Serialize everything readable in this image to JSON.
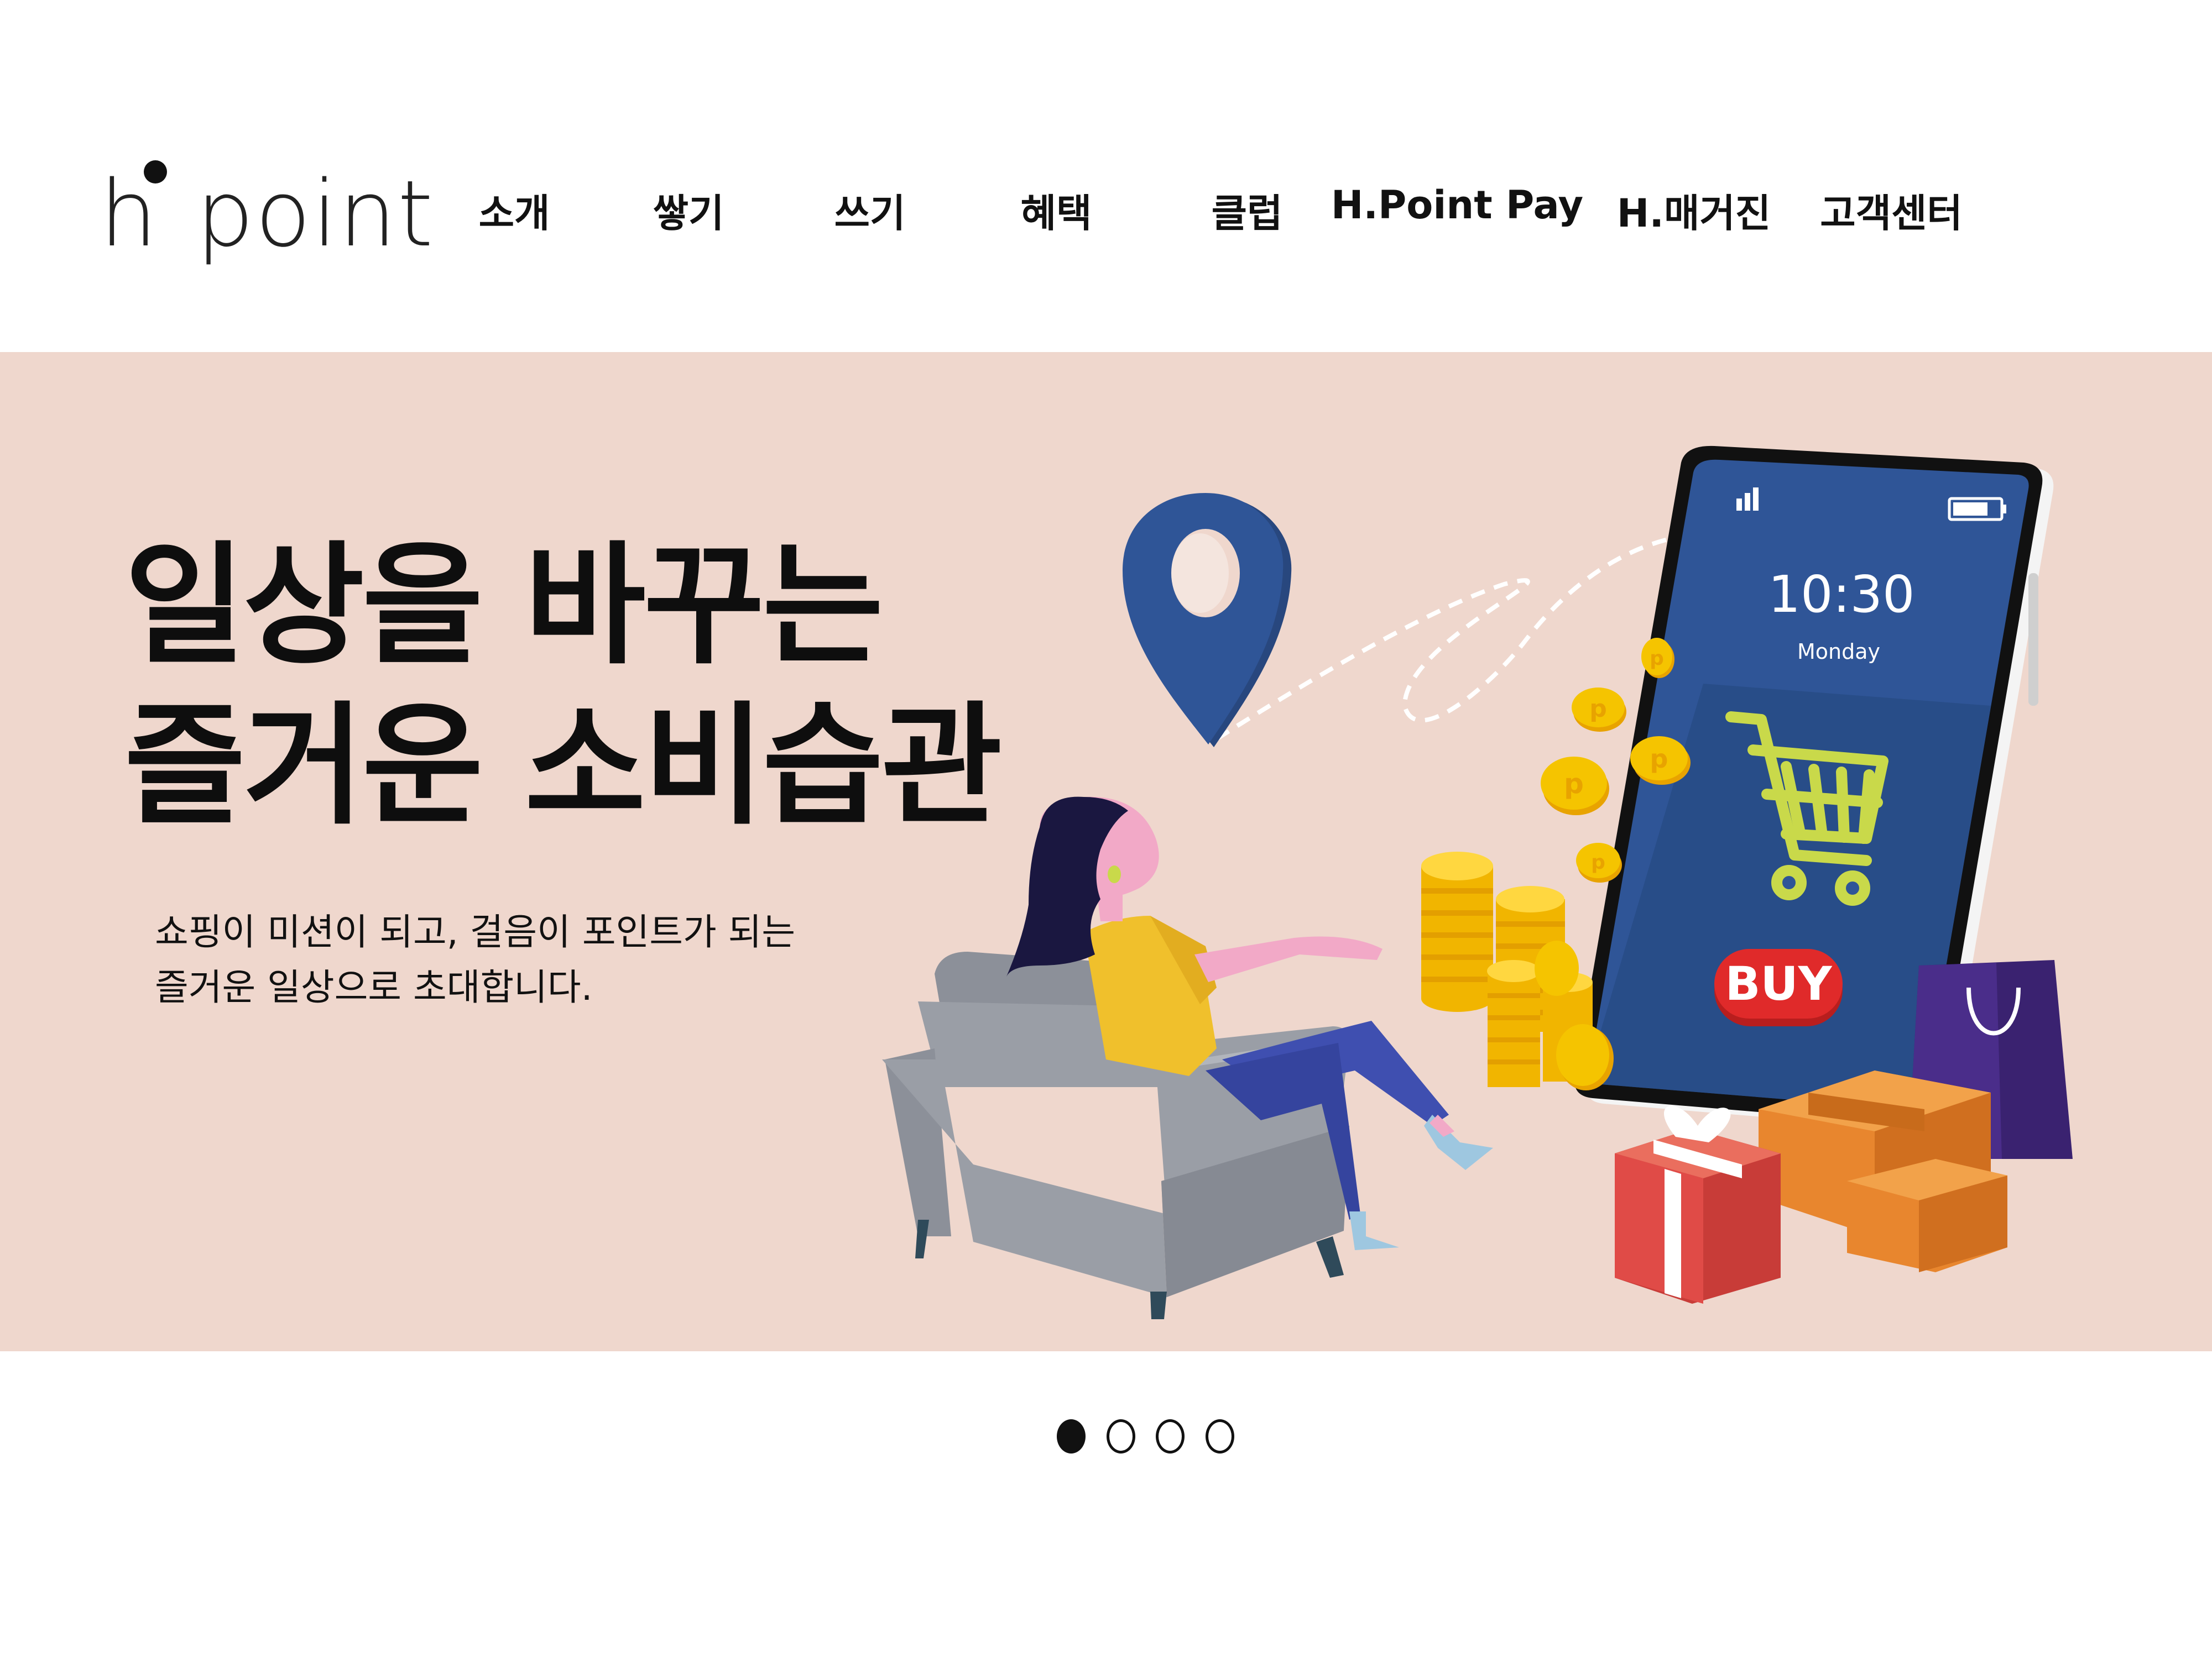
{
  "logo": {
    "letter": "h",
    "word": "point"
  },
  "nav": {
    "items": [
      {
        "label": "소개"
      },
      {
        "label": "쌓기"
      },
      {
        "label": "쓰기"
      },
      {
        "label": "혜택"
      },
      {
        "label": "클럽"
      },
      {
        "label": "H.Point Pay"
      },
      {
        "label": "H.매거진"
      },
      {
        "label": "고객센터"
      }
    ]
  },
  "hero": {
    "headline_line1": "일상을 바꾸는",
    "headline_line2": "즐거운 소비습관",
    "subtext_line1": "쇼핑이 미션이 되고, 걸음이 포인트가 되는",
    "subtext_line2": "즐거운 일상으로 초대합니다.",
    "background_color": "#efd7cd"
  },
  "phone": {
    "time": "10:30",
    "day": "Monday",
    "buy_label": "BUY"
  },
  "coin_letter": "p",
  "carousel": {
    "count": 4,
    "active_index": 0
  },
  "colors": {
    "phone_screen": "#2f5597",
    "pin": "#2f5597",
    "cart": "#c9d94a",
    "buy_button": "#e02a2a",
    "coin": "#f5c400",
    "chair": "#9a9ea6",
    "shirt": "#f0c02c",
    "jeans": "#3f4fb0",
    "box": "#e8862e",
    "gift": "#e04b47",
    "bag": "#4a2d8a"
  }
}
